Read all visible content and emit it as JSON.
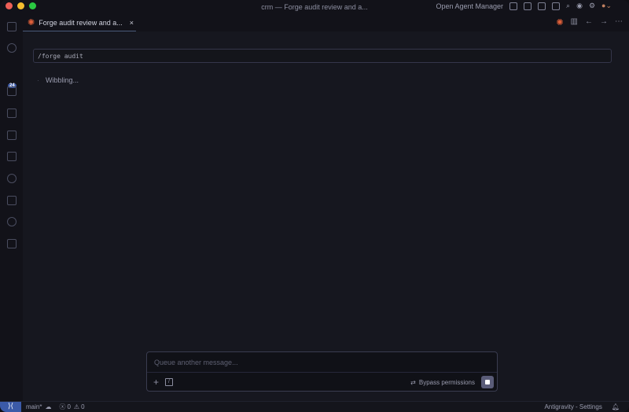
{
  "window": {
    "title": "crm — Forge audit review and a..."
  },
  "titlebar": {
    "open_agent_manager": "Open Agent Manager"
  },
  "activity_bar": {
    "source_control_badge": "24"
  },
  "tab": {
    "label": "Forge audit review and a...",
    "close": "×"
  },
  "main": {
    "command": "/forge audit",
    "status": "Wibbling..."
  },
  "composer": {
    "placeholder": "Queue another message...",
    "add": "+",
    "slash": "/",
    "bypass": "Bypass permissions"
  },
  "statusbar": {
    "branch": "main*",
    "errors": "0",
    "warnings": "0",
    "right": "Antigravity - Settings"
  }
}
